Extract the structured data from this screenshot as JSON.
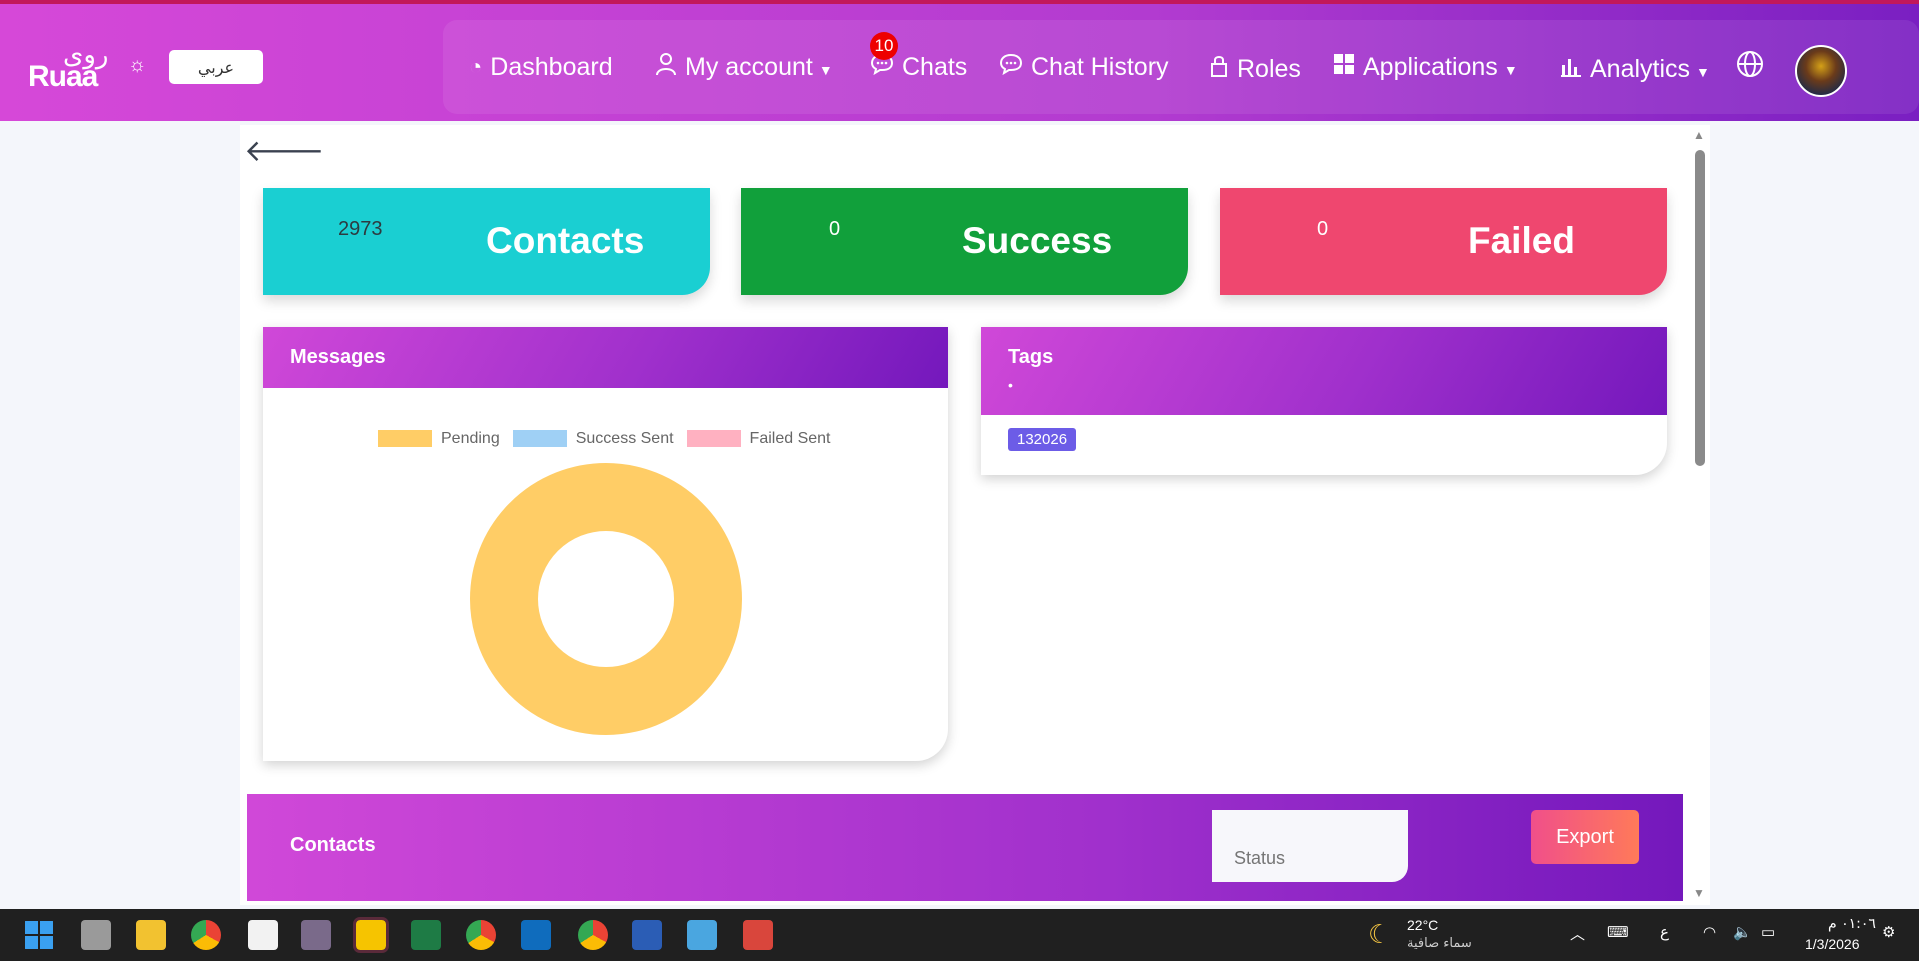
{
  "brand": {
    "name_ar": "روى",
    "name_en": "Ruaa"
  },
  "header": {
    "lang_button": "عربي",
    "nav": {
      "dashboard": "Dashboard",
      "my_account": "My account",
      "chats": "Chats",
      "chats_badge": "10",
      "chat_history": "Chat History",
      "roles": "Roles",
      "applications": "Applications",
      "analytics": "Analytics"
    }
  },
  "stats": {
    "contacts": {
      "value": "2973",
      "label": "Contacts",
      "color": "#1acfd2"
    },
    "success": {
      "value": "0",
      "label": "Success",
      "color": "#11a03b"
    },
    "failed": {
      "value": "0",
      "label": "Failed",
      "color": "#ef476f"
    }
  },
  "messages_panel": {
    "title": "Messages",
    "chart_data": {
      "type": "pie",
      "categories": [
        "Pending",
        "Success Sent",
        "Failed Sent"
      ],
      "values": [
        2973,
        0,
        0
      ],
      "colors": [
        "#ffcd66",
        "#9fd0f5",
        "#ffb1c1"
      ],
      "legend": "top"
    }
  },
  "tags_panel": {
    "title": "Tags",
    "dot": "•",
    "tag": "132026"
  },
  "contacts_bar": {
    "title": "Contacts",
    "status_placeholder": "Status",
    "export": "Export"
  },
  "taskbar": {
    "weather_temp": "22°C",
    "weather_desc": "سماء صافية",
    "ime": "ع",
    "time": "٠١:٠٦ م",
    "date": "1/3/2026"
  }
}
